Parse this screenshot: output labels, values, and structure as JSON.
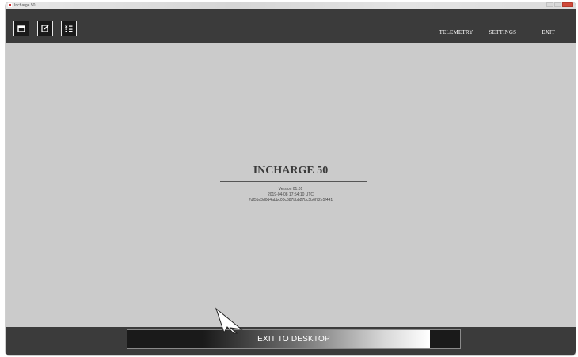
{
  "window": {
    "title": "Incharge 50"
  },
  "toolbar": {
    "buttons": [
      {
        "icon": "window-icon"
      },
      {
        "icon": "edit-icon"
      },
      {
        "icon": "checklist-icon"
      }
    ]
  },
  "nav": {
    "items": [
      "TELEMETRY",
      "SETTINGS",
      "EXIT"
    ],
    "active": "EXIT"
  },
  "about": {
    "product": "INCHARGE 50",
    "version": "Version 01.01",
    "build_date": "2019-04-08 17:54:10 UTC",
    "hash": "7df51e3d0d4abbc00c687bbb27bc5b6f72e5f441"
  },
  "exit": {
    "label": "EXIT TO DESKTOP",
    "progress": 0.91
  },
  "colors": {
    "bar": "#3b3b3b",
    "content": "#cbcbcb",
    "button": "#1a1a1a",
    "text_light": "#ffffff"
  }
}
